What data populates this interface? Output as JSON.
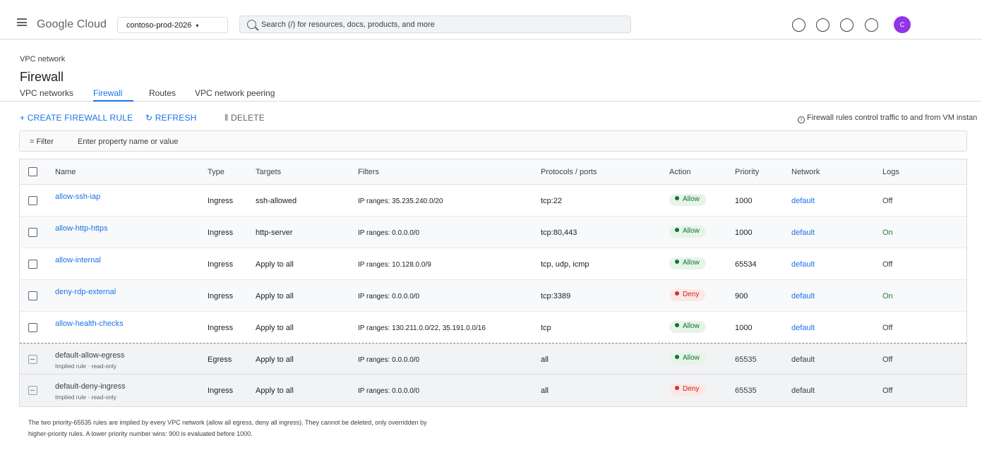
{
  "topbar": {
    "brand": "Google Cloud",
    "project": "contoso-prod-2026",
    "project_caret": "▾",
    "search_placeholder": "Search (/) for resources, docs, products, and more",
    "avatar_initial": "C"
  },
  "header": {
    "breadcrumb": "VPC network",
    "title": "Firewall",
    "tabs": [
      {
        "label": "VPC networks"
      },
      {
        "label": "Firewall",
        "active": true
      },
      {
        "label": "Routes"
      },
      {
        "label": "VPC network peering"
      }
    ]
  },
  "actions": {
    "create": "+ CREATE FIREWALL RULE",
    "refresh": "↻ REFRESH",
    "delete": "⦀ DELETE",
    "info_icon": "i",
    "info": "Firewall rules control traffic to and from VM instan"
  },
  "filter": {
    "label": "= Filter",
    "placeholder": "Enter property name or value"
  },
  "table": {
    "columns": [
      "Name",
      "Type",
      "Targets",
      "Filters",
      "Protocols / ports",
      "Action",
      "Priority",
      "Network",
      "Logs"
    ],
    "rows": [
      {
        "name": "allow-ssh-iap",
        "type": "Ingress",
        "targets": "ssh-allowed",
        "filters": "IP ranges: 35.235.240.0/20",
        "protocols": "tcp:22",
        "action": "Allow",
        "priority": "1000",
        "network": "default",
        "logs": "Off"
      },
      {
        "name": "allow-http-https",
        "type": "Ingress",
        "targets": "http-server",
        "filters": "IP ranges: 0.0.0.0/0",
        "protocols": "tcp:80,443",
        "action": "Allow",
        "priority": "1000",
        "network": "default",
        "logs": "On"
      },
      {
        "name": "allow-internal",
        "type": "Ingress",
        "targets": "Apply to all",
        "filters": "IP ranges: 10.128.0.0/9",
        "protocols": "tcp, udp, icmp",
        "action": "Allow",
        "priority": "65534",
        "network": "default",
        "logs": "Off"
      },
      {
        "name": "deny-rdp-external",
        "type": "Ingress",
        "targets": "Apply to all",
        "filters": "IP ranges: 0.0.0.0/0",
        "protocols": "tcp:3389",
        "action": "Deny",
        "priority": "900",
        "network": "default",
        "logs": "On"
      },
      {
        "name": "allow-health-checks",
        "type": "Ingress",
        "targets": "Apply to all",
        "filters": "IP ranges: 130.211.0.0/22, 35.191.0.0/16",
        "protocols": "tcp",
        "action": "Allow",
        "priority": "1000",
        "network": "default",
        "logs": "Off"
      },
      {
        "name": "default-allow-egress",
        "sub": "Implied rule · read-only",
        "type": "Egress",
        "targets": "Apply to all",
        "filters": "IP ranges: 0.0.0.0/0",
        "protocols": "all",
        "action": "Allow",
        "priority": "65535",
        "network": "default",
        "logs": "Off"
      },
      {
        "name": "default-deny-ingress",
        "sub": "Implied rule · read-only",
        "type": "Ingress",
        "targets": "Apply to all",
        "filters": "IP ranges: 0.0.0.0/0",
        "protocols": "all",
        "action": "Deny",
        "priority": "65535",
        "network": "default",
        "logs": "Off"
      }
    ]
  },
  "footnote": {
    "line1": "The two priority-65535 rules are implied by every VPC network (allow all egress, deny all ingress). They cannot be deleted, only overridden by",
    "line2": "higher-priority rules. A lower priority number wins: 900 is evaluated before 1000."
  },
  "colors": {
    "accent": "#1a73e8",
    "allow": "#137333",
    "deny": "#c5221f",
    "avatar": "#9334e6"
  }
}
